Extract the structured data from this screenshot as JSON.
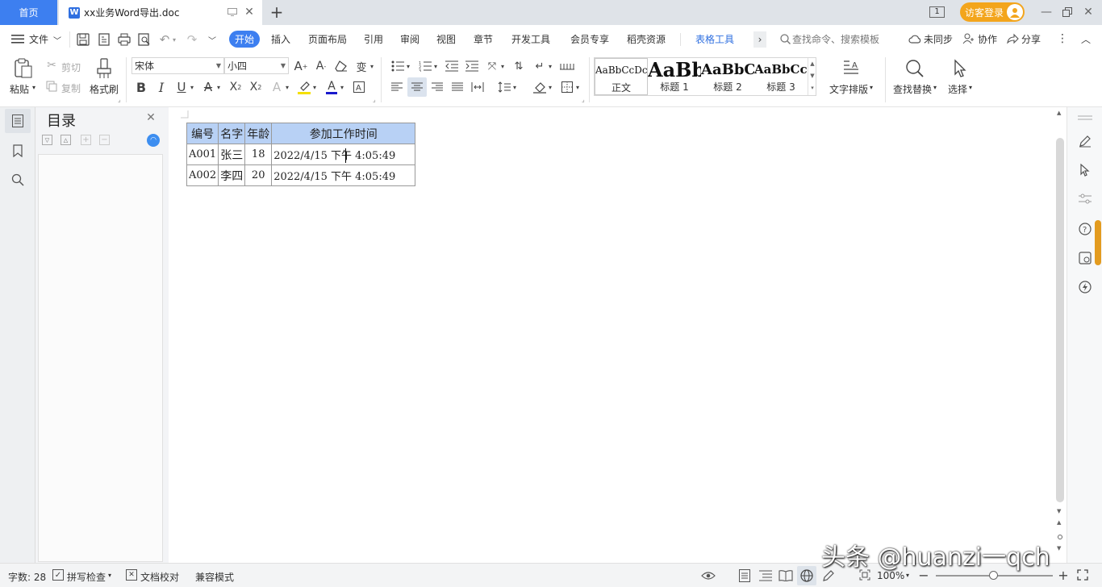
{
  "titlebar": {
    "home_tab": "首页",
    "doc_tab": "xx业务Word导出.doc",
    "doc_icon_letter": "W",
    "page_indicator": "1",
    "login_button": "访客登录"
  },
  "ribbon": {
    "file_menu": "文件",
    "tabs": [
      "开始",
      "插入",
      "页面布局",
      "引用",
      "审阅",
      "视图",
      "章节",
      "开发工具",
      "会员专享",
      "稻壳资源",
      "表格工具"
    ],
    "active_tab": "开始",
    "search_placeholder": "查找命令、搜索模板",
    "sync_status": "未同步",
    "collab": "协作",
    "share": "分享"
  },
  "toolbar": {
    "paste": "粘贴",
    "cut": "剪切",
    "copy": "复制",
    "format_painter": "格式刷",
    "font_name": "宋体",
    "font_size": "小四",
    "styles": [
      {
        "preview": "AaBbCcDc",
        "name": "正文"
      },
      {
        "preview": "AaBb",
        "name": "标题 1"
      },
      {
        "preview": "AaBbC",
        "name": "标题 2"
      },
      {
        "preview": "AaBbCcI",
        "name": "标题 3"
      }
    ],
    "text_layout": "文字排版",
    "find_replace": "查找替换",
    "select": "选择"
  },
  "nav": {
    "title": "目录"
  },
  "document": {
    "table": {
      "headers": [
        "编号",
        "名字",
        "年龄",
        "参加工作时间"
      ],
      "rows": [
        [
          "A001",
          "张三",
          "18",
          "2022/4/15 下午 4:05:49"
        ],
        [
          "A002",
          "李四",
          "20",
          "2022/4/15 下午 4:05:49"
        ]
      ]
    }
  },
  "status": {
    "word_count": "字数: 28",
    "spell_check": "拼写检查",
    "doc_proof": "文档校对",
    "compat_mode": "兼容模式",
    "zoom": "100%"
  },
  "watermark": "头条 @huanzi一qch"
}
